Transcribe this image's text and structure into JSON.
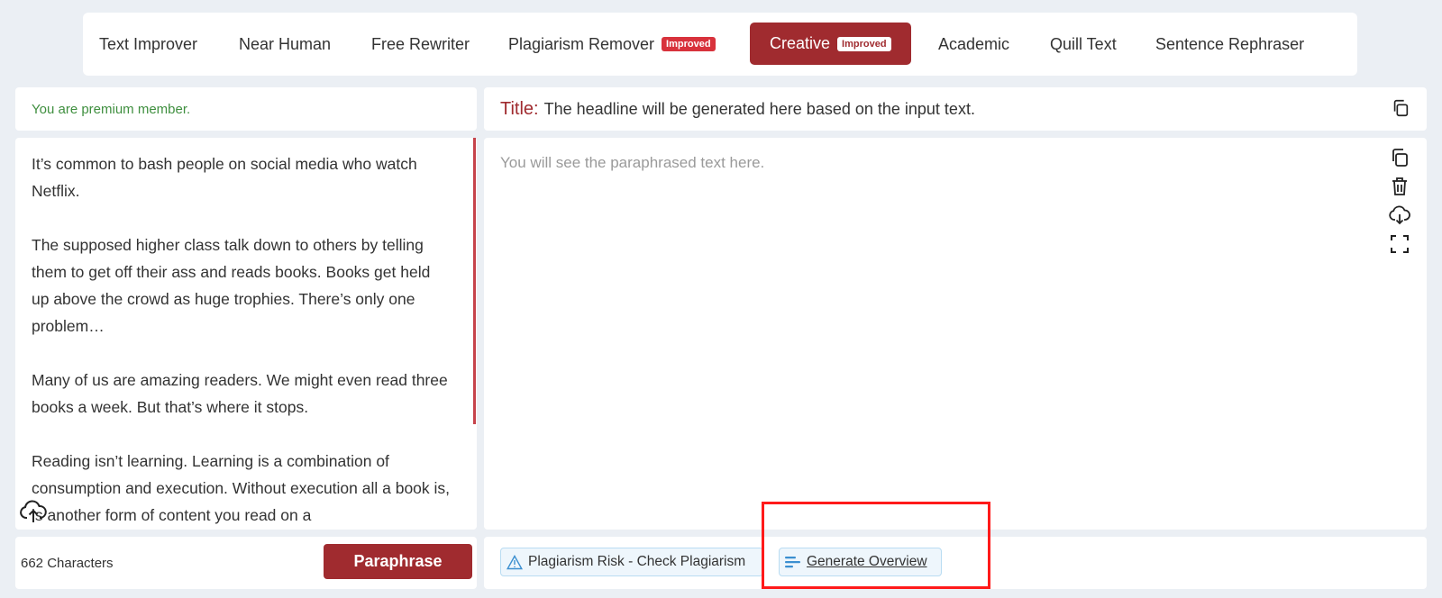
{
  "modes": [
    {
      "label": "Text Improver",
      "badge": "",
      "active": false
    },
    {
      "label": "Near Human",
      "badge": "",
      "active": false
    },
    {
      "label": "Free Rewriter",
      "badge": "",
      "active": false
    },
    {
      "label": "Plagiarism Remover",
      "badge": "Improved",
      "active": false
    },
    {
      "label": "Creative",
      "badge": "Improved",
      "active": true
    },
    {
      "label": "Academic",
      "badge": "",
      "active": false
    },
    {
      "label": "Quill Text",
      "badge": "",
      "active": false
    },
    {
      "label": "Sentence Rephraser",
      "badge": "",
      "active": false
    }
  ],
  "premium_message": "You are premium member.",
  "title": {
    "label": "Title:",
    "text": "The headline will be generated here based on the input text."
  },
  "input": {
    "paragraphs": [
      "It’s common to bash people on social media who watch Netflix.",
      "The supposed higher class talk down to others by telling them to get off their ass and reads books. Books get held up above the crowd as huge trophies. There’s only one problem…",
      "Many of us are amazing readers. We might even read three books a week. But that’s where it stops.",
      "Reading isn’t learning. Learning is a combination of consumption and execution. Without execution all a book is, is another form of content you read on a"
    ],
    "char_count": "662 Characters"
  },
  "output": {
    "placeholder": "You will see the paraphrased text here."
  },
  "buttons": {
    "paraphrase": "Paraphrase",
    "plagiarism_check": "Plagiarism Risk - Check Plagiarism",
    "generate_overview": "Generate Overview"
  },
  "colors": {
    "brand": "#a02b2f",
    "badge": "#d8323c",
    "premium_text": "#3f8f3f",
    "action_bg": "#eef6fc",
    "highlight_box": "#ff1a1a"
  },
  "icons": {
    "title_copy": "copy-icon",
    "output_tools": [
      "copy-icon",
      "trash-icon",
      "download-cloud-icon",
      "fullscreen-icon"
    ],
    "upload": "upload-cloud-icon",
    "plagiarism": "warning-triangle-icon",
    "overview": "lines-icon"
  }
}
